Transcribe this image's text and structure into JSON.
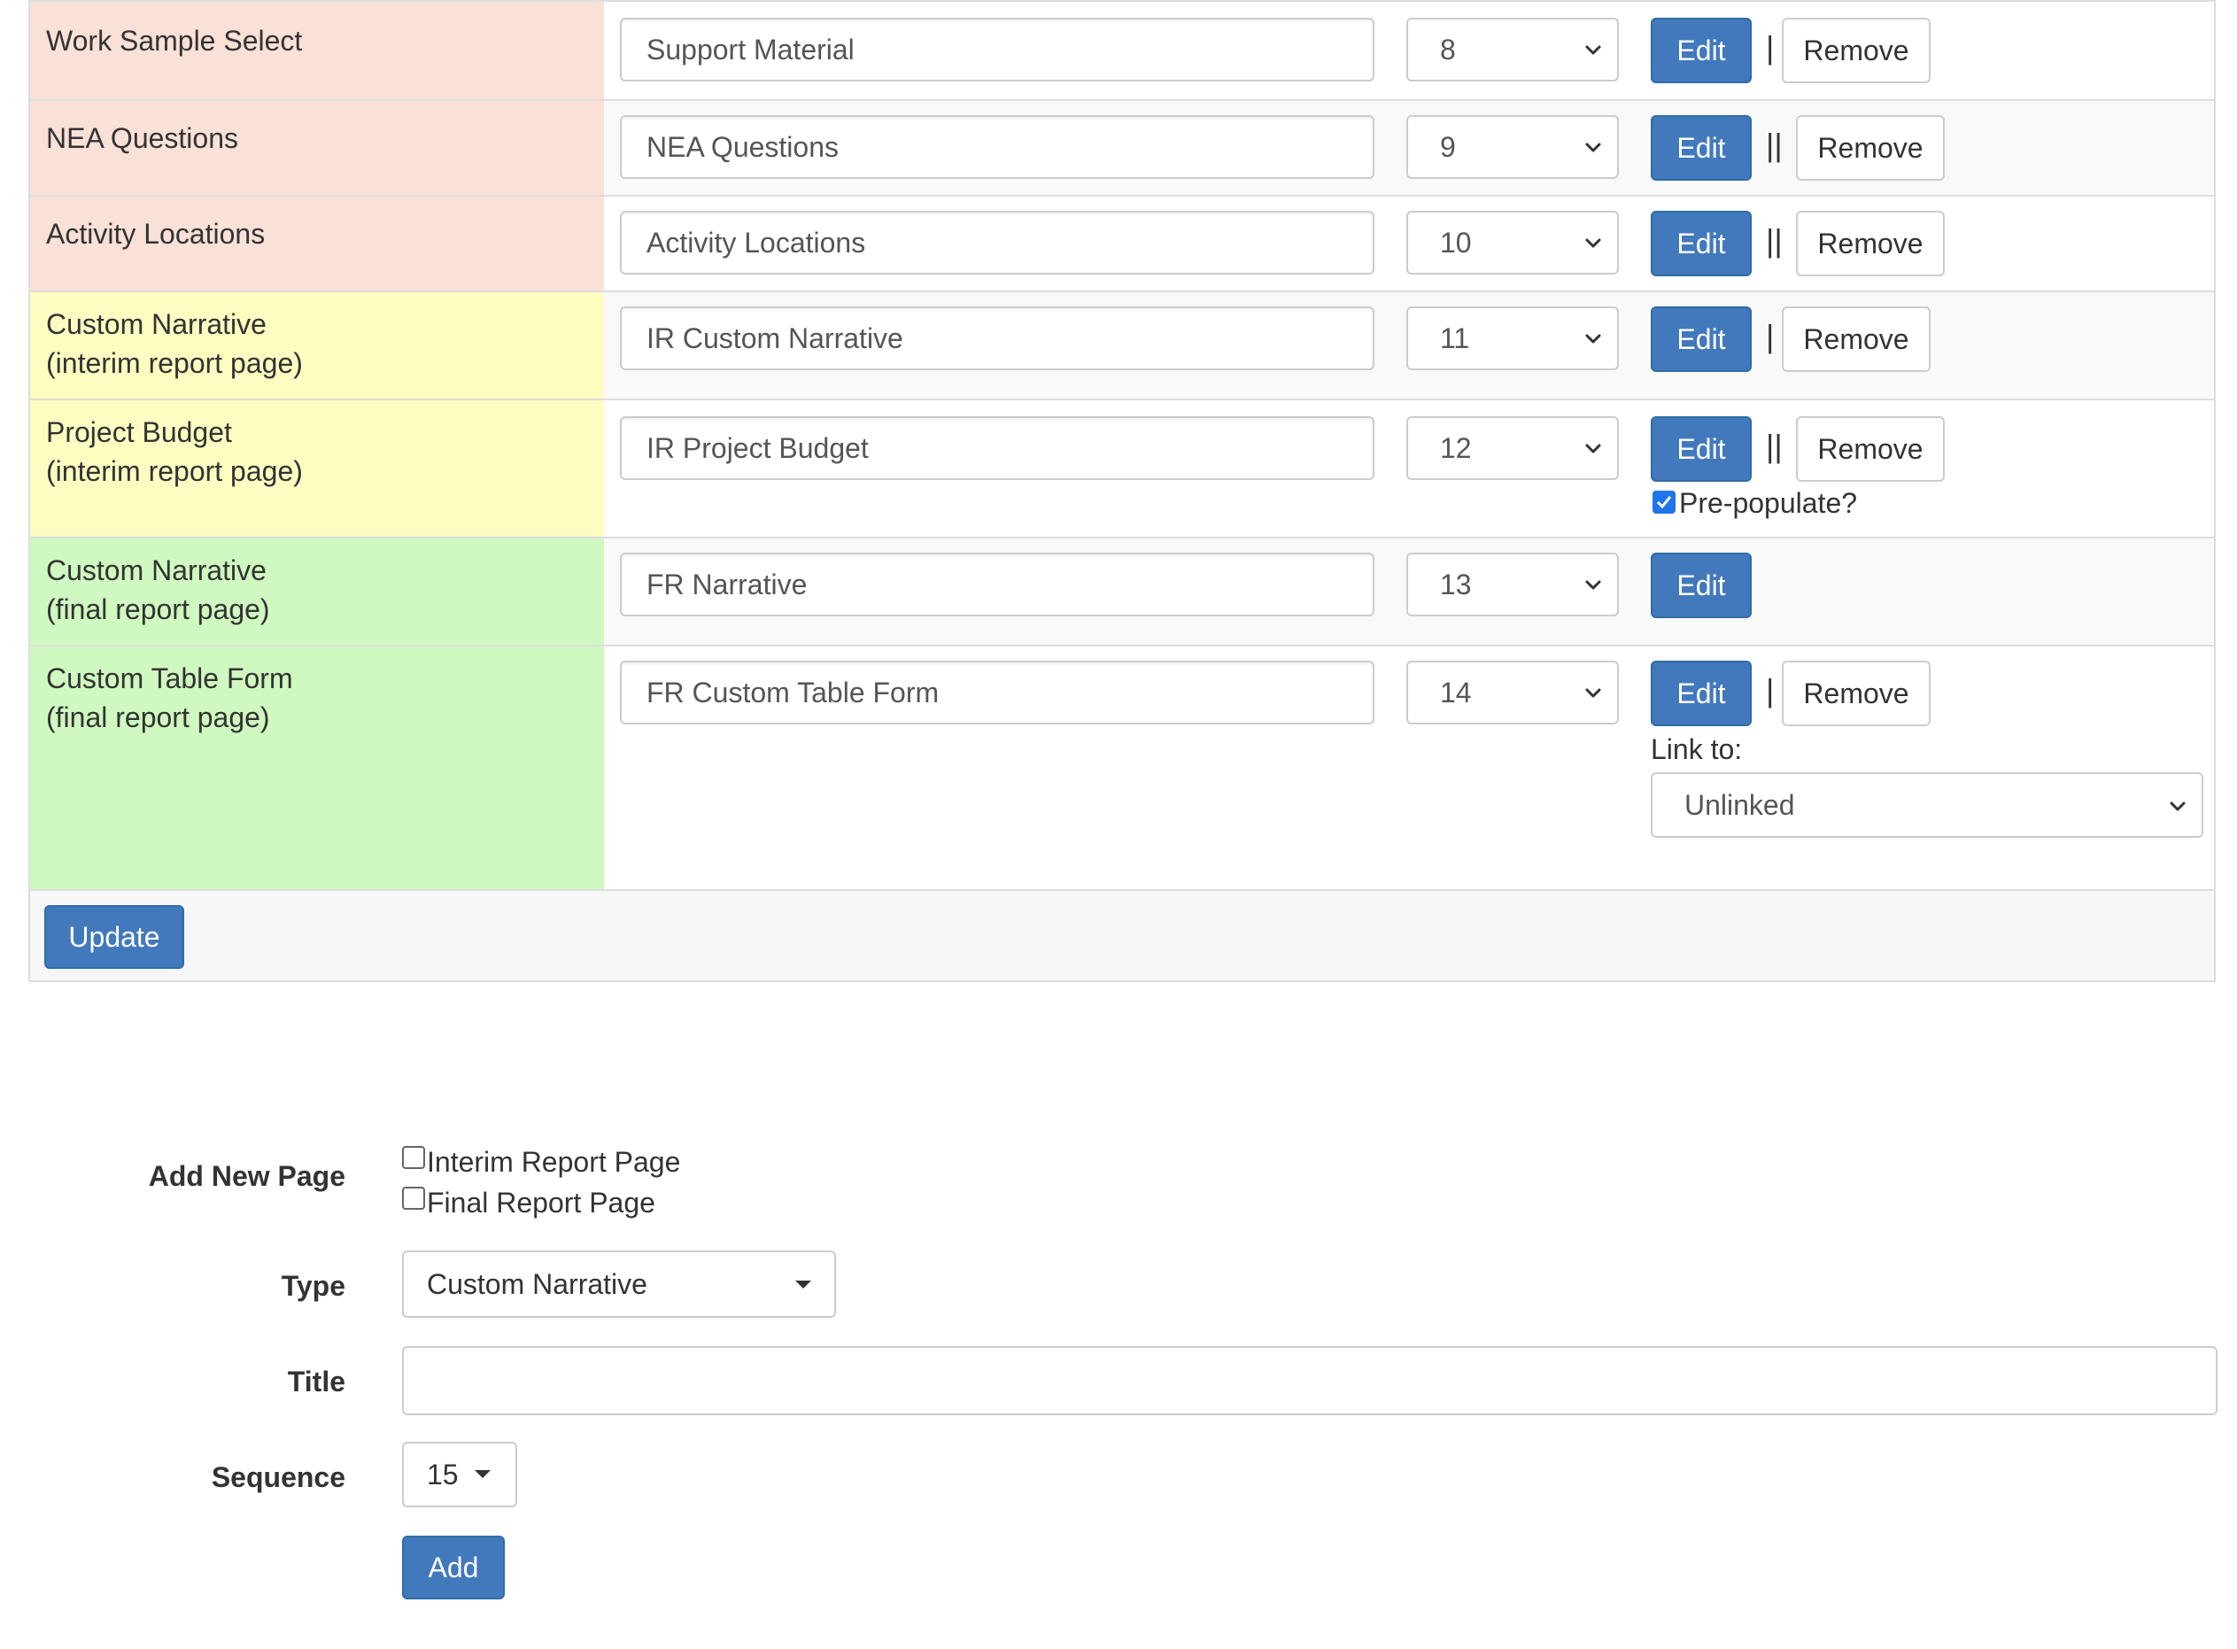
{
  "rows": [
    {
      "label1": "Work Sample Select",
      "label2": "",
      "title": "Support Material",
      "sequence": "8",
      "edit": "Edit",
      "separator": "|",
      "remove": "Remove"
    },
    {
      "label1": "NEA Questions",
      "label2": "",
      "title": "NEA Questions",
      "sequence": "9",
      "edit": "Edit",
      "separator": "||",
      "remove": "Remove"
    },
    {
      "label1": "Activity Locations",
      "label2": "",
      "title": "Activity Locations",
      "sequence": "10",
      "edit": "Edit",
      "separator": "||",
      "remove": "Remove"
    },
    {
      "label1": "Custom Narrative",
      "label2": "(interim report page)",
      "title": "IR Custom Narrative",
      "sequence": "11",
      "edit": "Edit",
      "separator": "|",
      "remove": "Remove"
    },
    {
      "label1": "Project Budget",
      "label2": "(interim report page)",
      "title": "IR Project Budget",
      "sequence": "12",
      "edit": "Edit",
      "separator": "||",
      "remove": "Remove",
      "prepopulate_label": "Pre-populate?",
      "prepopulate_checked": true
    },
    {
      "label1": "Custom Narrative",
      "label2": "(final report page)",
      "title": "FR Narrative",
      "sequence": "13",
      "edit": "Edit"
    },
    {
      "label1": "Custom Table Form",
      "label2": "(final report page)",
      "title": "FR Custom Table Form",
      "sequence": "14",
      "edit": "Edit",
      "separator": "|",
      "remove": "Remove",
      "link_label": "Link to:",
      "link_value": "Unlinked"
    }
  ],
  "update_button": "Update",
  "add_form": {
    "heading": "Add New Page",
    "interim_label": "Interim Report Page",
    "final_label": "Final Report Page",
    "type_label": "Type",
    "type_value": "Custom Narrative",
    "title_label": "Title",
    "title_value": "",
    "sequence_label": "Sequence",
    "sequence_value": "15",
    "add_button": "Add"
  },
  "colors": {
    "salmon": "#f9e1d8",
    "yellow": "#fefdc1",
    "green": "#cff9c0",
    "primary": "#4279bd"
  }
}
